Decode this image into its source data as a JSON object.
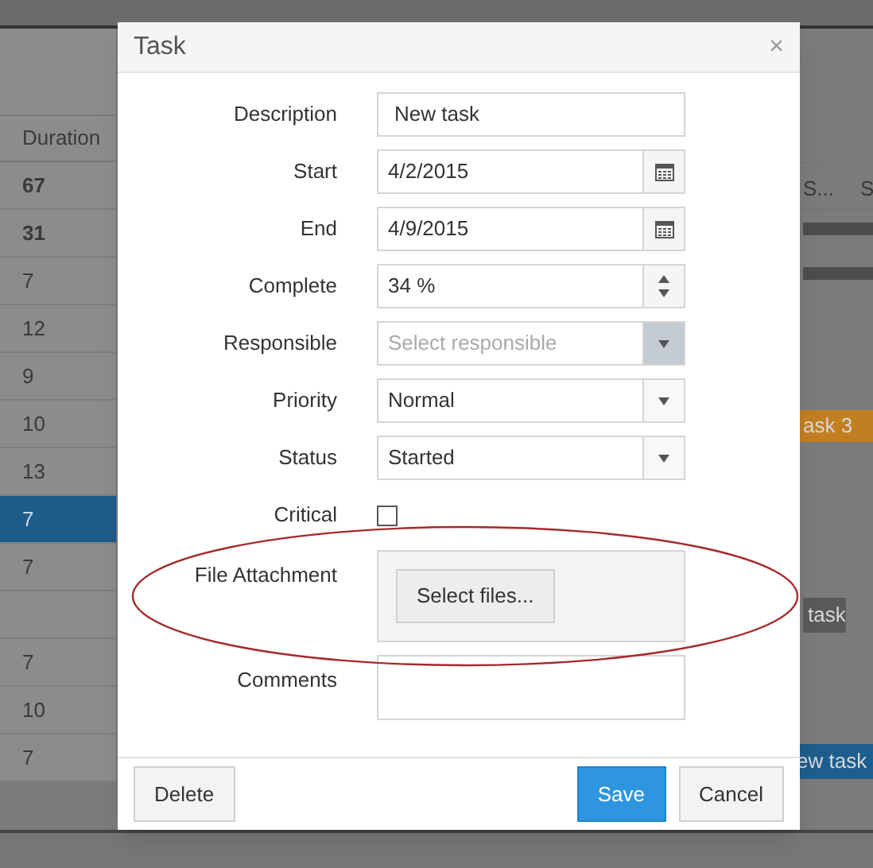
{
  "background": {
    "column_header": "Duration",
    "rows": [
      {
        "duration": "67",
        "bold": true,
        "selected": false
      },
      {
        "duration": "31",
        "bold": true,
        "selected": false
      },
      {
        "duration": "7",
        "bold": false,
        "selected": false
      },
      {
        "duration": "12",
        "bold": false,
        "selected": false
      },
      {
        "duration": "9",
        "bold": false,
        "selected": false
      },
      {
        "duration": "10",
        "bold": false,
        "selected": false
      },
      {
        "duration": "13",
        "bold": false,
        "selected": false
      },
      {
        "duration": "7",
        "bold": false,
        "selected": true
      },
      {
        "duration": "7",
        "bold": false,
        "selected": false
      },
      {
        "selected": false
      },
      {
        "duration": "7",
        "bold": false,
        "selected": false
      },
      {
        "duration": "10",
        "bold": false,
        "selected": false
      },
      {
        "duration": "7",
        "bold": false,
        "selected": false
      }
    ],
    "timeline_headers": [
      "S...",
      "S"
    ],
    "task_bars": [
      {
        "label": "ask 3",
        "color": "#c27f22"
      },
      {
        "label": "task",
        "color": "#5a5a5a"
      },
      {
        "label": "ew task",
        "color": "#1d5e8c"
      }
    ]
  },
  "dialog": {
    "title": "Task",
    "close": "×",
    "fields": [
      {
        "kind": "text",
        "label": "Description",
        "value": "New task"
      },
      {
        "kind": "date",
        "label": "Start",
        "value": "4/2/2015"
      },
      {
        "kind": "date",
        "label": "End",
        "value": "4/9/2015"
      },
      {
        "kind": "numeric",
        "label": "Complete",
        "value": "34 %"
      },
      {
        "kind": "select",
        "label": "Responsible",
        "placeholder": "Select responsible",
        "hover": true
      },
      {
        "kind": "select",
        "label": "Priority",
        "value": "Normal",
        "hover": false
      },
      {
        "kind": "select",
        "label": "Status",
        "value": "Started",
        "hover": false
      },
      {
        "kind": "checkbox",
        "label": "Critical",
        "checked": false
      },
      {
        "kind": "upload",
        "label": "File Attachment",
        "button": "Select files..."
      },
      {
        "kind": "textarea",
        "label": "Comments"
      }
    ],
    "buttons_left": [
      {
        "label": "Delete",
        "primary": false
      }
    ],
    "buttons_right": [
      {
        "label": "Save",
        "primary": true
      },
      {
        "label": "Cancel",
        "primary": false
      }
    ]
  }
}
